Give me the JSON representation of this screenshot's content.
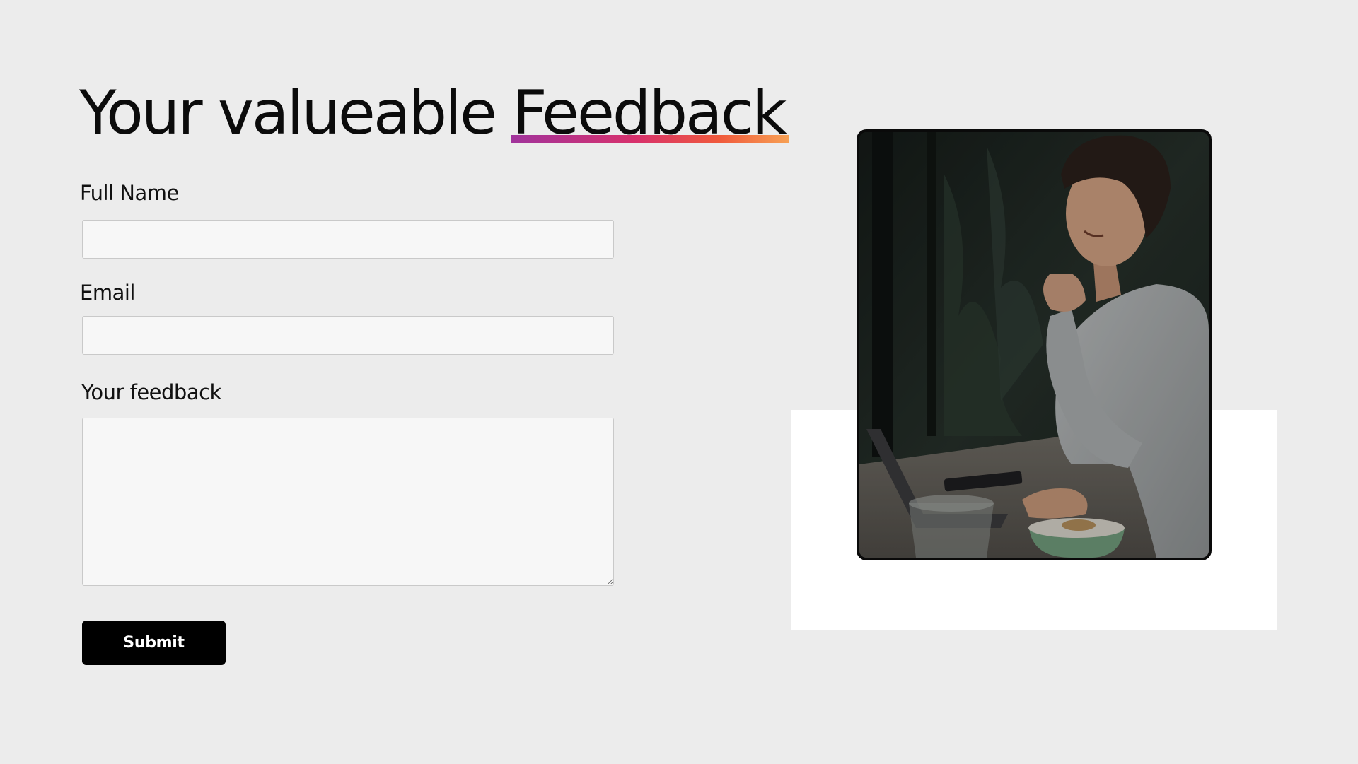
{
  "title": {
    "prefix": "Your valueable ",
    "highlight": "Feedback",
    "gradient": [
      "#a0339c",
      "#d8316c",
      "#f05a3c",
      "#f7a154"
    ]
  },
  "form": {
    "full_name": {
      "label": "Full Name",
      "value": "",
      "placeholder": ""
    },
    "email": {
      "label": "Email",
      "value": "",
      "placeholder": ""
    },
    "feedback": {
      "label": "Your feedback",
      "value": "",
      "placeholder": ""
    },
    "submit_label": "Submit"
  },
  "image": {
    "alt": "",
    "description": ""
  },
  "colors": {
    "background": "#ececec",
    "panel": "#ffffff",
    "button": "#000000",
    "button_text": "#ffffff",
    "field_bg": "#f7f7f7",
    "field_border": "#c9c9c9"
  }
}
